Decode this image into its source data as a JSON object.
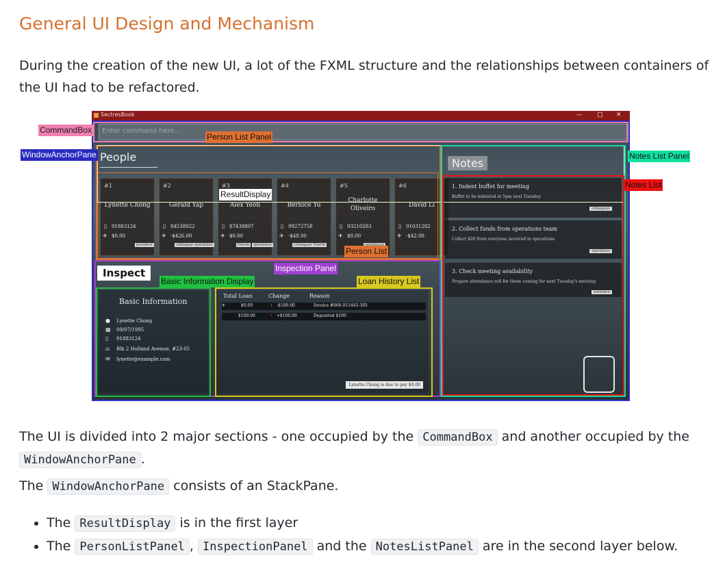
{
  "heading": "General UI Design and Mechanism",
  "intro": "During the creation of the new UI, a lot of the FXML structure and the relationships between containers of the UI had to be refactored.",
  "screenshot": {
    "window_title": "SectresBook",
    "window_controls": [
      "—",
      "□",
      "✕"
    ],
    "command_placeholder": "Enter command here...",
    "people_title": "People",
    "notes_title": "Notes",
    "inspect_title": "Inspect",
    "labels": {
      "commandbox": "CommandBox",
      "windowanchorpane": "WindowAnchorPane",
      "person_list_panel": "Person List Panel",
      "result_display": "ResultDisplay",
      "notes_list_panel": "Notes List Panel",
      "notes_list": "Notes List",
      "person_list": "Person List",
      "inspection_panel": "Inspection Panel",
      "basic_information_display": "Basic Information Display",
      "loan_history_list": "Loan History List"
    },
    "persons": [
      {
        "num": "#1",
        "name": "Lynette Chong",
        "phone": "91883124",
        "loan": "$0.00",
        "tags": [
          "president"
        ]
      },
      {
        "num": "#2",
        "name": "Gerald Yap",
        "phone": "84538922",
        "loan": "-$426.00",
        "tags": [
          "colleagues",
          "operations"
        ]
      },
      {
        "num": "#3",
        "name": "Alex Yeoh",
        "phone": "87438807",
        "loan": "$0.00",
        "tags": [
          "friends",
          "operations"
        ]
      },
      {
        "num": "#4",
        "name": "Bernice Yu",
        "phone": "99272758",
        "loan": "-$48.00",
        "tags": [
          "colleagues",
          "friends"
        ]
      },
      {
        "num": "#5",
        "name": "Charlotte Oliveiro",
        "phone": "93210283",
        "loan": "$0.00",
        "tags": [
          "neighbours"
        ]
      },
      {
        "num": "#6",
        "name": "David Li",
        "phone": "91031282",
        "loan": "-$42.00",
        "tags": []
      }
    ],
    "notes": [
      {
        "title": "1.  Indent buffet for meeting",
        "desc": "Buffet to be indented at 5pm next Tuesday",
        "tag": "colleagues"
      },
      {
        "title": "2.  Collect funds from operations team",
        "desc": "Collect $20 from everyone involved in operations",
        "tag": "operations"
      },
      {
        "title": "3.  Check meeting availability",
        "desc": "Prepare attendance roll for those coming for next Tuesday's meeting",
        "tag": "president"
      }
    ],
    "basic_info": {
      "header": "Basic Information",
      "name": "Lynette Chong",
      "birthday": "09/07/1995",
      "phone": "91883124",
      "address": "Blk 2 Holland Avenue, #23-05",
      "email": "lynette@example.com"
    },
    "loan_history": {
      "headers": [
        "Total Loan",
        "Change",
        "Reason"
      ],
      "rows": [
        {
          "total": "$0.00",
          "change": "-$100.00",
          "reason": "Invoice #066-011445-305"
        },
        {
          "total": "$100.00",
          "change": "+$100.00",
          "reason": "Deposited $100"
        }
      ],
      "due_text": "Lynette Chong is due to pay $0.00"
    }
  },
  "para1": {
    "t1": "The UI is divided into 2 major sections - one occupied by the ",
    "c1": "CommandBox",
    "t2": " and another occupied by the ",
    "c2": "WindowAnchorPane",
    "t3": "."
  },
  "para2": {
    "t1": "The ",
    "c1": "WindowAnchorPane",
    "t2": " consists of an StackPane."
  },
  "bullets": {
    "b1": {
      "t1": "The ",
      "c1": "ResultDisplay",
      "t2": " is in the first layer"
    },
    "b2": {
      "t1": "The ",
      "c1": "PersonListPanel",
      "t2": ", ",
      "c2": "InspectionPanel",
      "t3": " and the ",
      "c3": "NotesListPanel",
      "t4": " are in the second layer below."
    }
  },
  "colors": {
    "heading": "#d4712e",
    "titlebar": "#8b1a1a",
    "commandbox": "#f080b0",
    "windowanchorpane": "#2a2ac0",
    "person_list_panel": "#e07030",
    "result_display": "#ffffff",
    "notes_list_panel": "#10e0a0",
    "notes_list": "#ee1111",
    "person_list": "#e07030",
    "inspection_panel": "#a040d0",
    "basic_info": "#20c040",
    "loan_history": "#d8c820"
  }
}
